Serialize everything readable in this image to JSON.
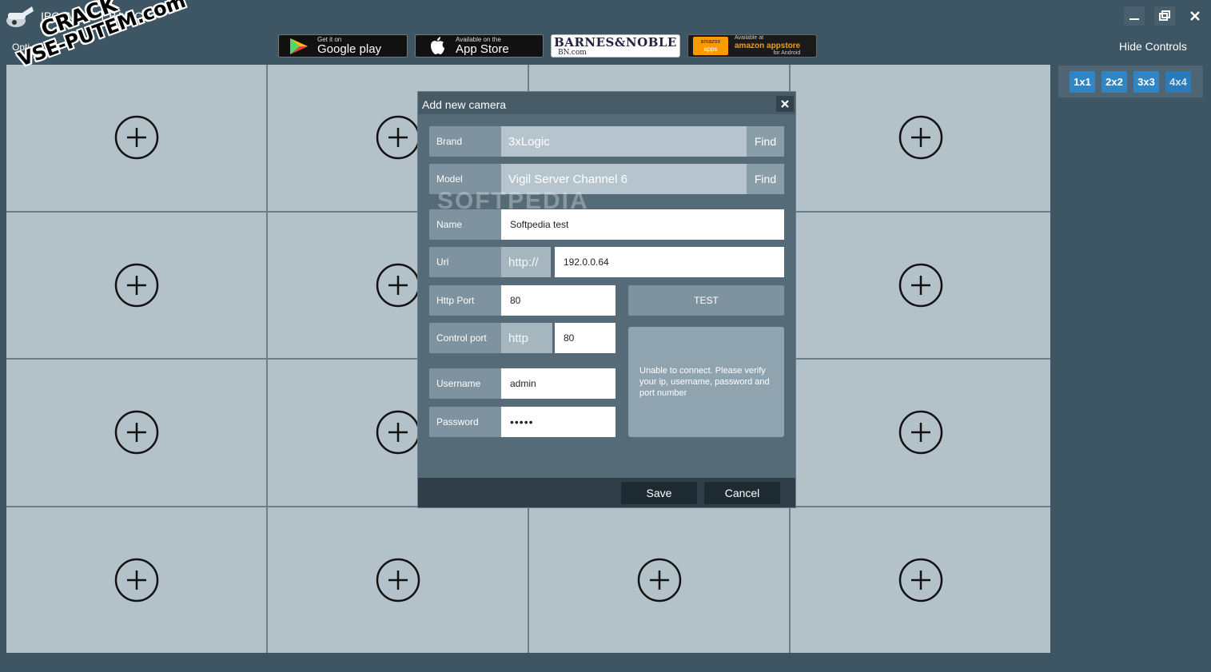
{
  "app": {
    "title": "IPCAMSOFT BASIC",
    "options_label": "Opti"
  },
  "window_controls": {
    "minimize": "minimize-icon",
    "restore": "restore-icon",
    "close": "close-icon"
  },
  "store_badges": {
    "google_play": {
      "small": "Get it on",
      "big": "Google play"
    },
    "app_store": {
      "small": "Available on the",
      "big": "App Store"
    },
    "barnes_noble": {
      "title": "BARNES&NOBLE",
      "sub": "BN.com"
    },
    "amazon": {
      "small": "amazon",
      "sub": "apps",
      "available": "Available at",
      "brand": "amazon appstore",
      "for": "for Android"
    }
  },
  "hide_controls": "Hide Controls",
  "watermark": {
    "line1": "CRACK",
    "line2": "VSE-PUTEM.com"
  },
  "layout_buttons": [
    "1x1",
    "2x2",
    "3x3",
    "4x4"
  ],
  "active_layout": "4x4",
  "grid": {
    "rows": 4,
    "cols": 4,
    "cell_icon": "add-camera-plus-icon"
  },
  "dialog": {
    "title": "Add new camera",
    "brand": {
      "label": "Brand",
      "value": "3xLogic",
      "find": "Find"
    },
    "model": {
      "label": "Model",
      "value": "Vigil Server Channel 6",
      "find": "Find"
    },
    "name": {
      "label": "Name",
      "value": "Softpedia test"
    },
    "url": {
      "label": "Url",
      "prefix": "http://",
      "value": "192.0.0.64"
    },
    "http_port": {
      "label": "Http Port",
      "value": "80"
    },
    "control_port": {
      "label": "Control port",
      "prefix": "http",
      "value": "80"
    },
    "username": {
      "label": "Username",
      "value": "admin"
    },
    "password": {
      "label": "Password",
      "value": "•••••"
    },
    "test_button": "TEST",
    "status_message": "Unable to connect. Please verify your ip, username, password and port number",
    "softpedia_watermark": "SOFTPEDIA",
    "save": "Save",
    "cancel": "Cancel"
  },
  "colors": {
    "background": "#3e5563",
    "cell": "#b3c1c9",
    "accent": "#2f86c6",
    "dialog": "#566b78"
  }
}
